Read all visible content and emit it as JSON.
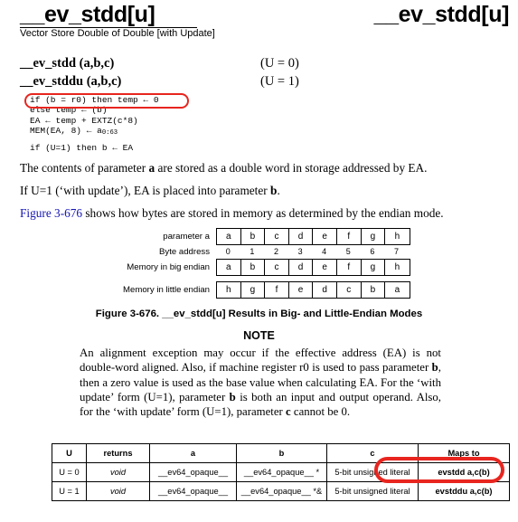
{
  "header": {
    "title_left": "__ev_stdd[u]",
    "title_right": "__ev_stdd[u]",
    "subtitle": "Vector Store Double of Double [with Update]"
  },
  "signatures": [
    {
      "name": "__ev_stdd (a,b,c)",
      "condition": "(U = 0)"
    },
    {
      "name": "__ev_stddu (a,b,c)",
      "condition": "(U = 1)"
    }
  ],
  "pseudocode": {
    "line1": "if (b = r0) then temp ← 0",
    "line2": "else temp ← (b)",
    "line3": "EA ← temp + EXTZ(c*8)",
    "line4_prefix": "MEM(EA, 8) ← a",
    "line4_sub": "0:63",
    "line5": "if (U=1) then b ← EA"
  },
  "paragraphs": {
    "p1_a": "The contents of parameter ",
    "p1_b": "a",
    "p1_c": " are stored as a double word in storage addressed by EA.",
    "p2_a": "If U=1 (‘with update’), EA is placed into parameter ",
    "p2_b": "b",
    "p2_c": ".",
    "p3_link": "Figure 3-676",
    "p3_rest": " shows how bytes are stored in memory as determined by the endian mode."
  },
  "byte_figure": {
    "rows": [
      {
        "label": "parameter a",
        "boxed": true,
        "cells": [
          "a",
          "b",
          "c",
          "d",
          "e",
          "f",
          "g",
          "h"
        ]
      },
      {
        "label": "Byte address",
        "boxed": false,
        "cells": [
          "0",
          "1",
          "2",
          "3",
          "4",
          "5",
          "6",
          "7"
        ]
      },
      {
        "label": "Memory in big endian",
        "boxed": true,
        "cells": [
          "a",
          "b",
          "c",
          "d",
          "e",
          "f",
          "g",
          "h"
        ]
      },
      {
        "label": "Memory in little endian",
        "boxed": true,
        "cells": [
          "h",
          "g",
          "f",
          "e",
          "d",
          "c",
          "b",
          "a"
        ]
      }
    ],
    "caption": "Figure 3-676.  __ev_stdd[u] Results in Big- and Little-Endian Modes"
  },
  "note": {
    "title": "NOTE",
    "body_1": "An alignment exception may occur if the effective address (EA) is not double-word aligned. Also, if machine register r0 is used to pass parameter ",
    "body_b1": "b",
    "body_2": ", then a zero value is used as the base value when calculating EA. For the ‘with update’ form (U=1), parameter ",
    "body_b2": "b",
    "body_3": " is both an input and output operand. Also, for the ‘with update’ form (U=1), parameter ",
    "body_b3": "c",
    "body_4": " cannot be 0."
  },
  "mapping_table": {
    "headers": [
      "U",
      "returns",
      "a",
      "b",
      "c",
      "Maps to"
    ],
    "rows": [
      {
        "u": "U = 0",
        "returns": "void",
        "a": "__ev64_opaque__",
        "b": "__ev64_opaque__ *",
        "c": "5-bit unsigned literal",
        "maps_to": "evstdd a,c(b)"
      },
      {
        "u": "U = 1",
        "returns": "void",
        "a": "__ev64_opaque__",
        "b": "__ev64_opaque__ *&",
        "c": "5-bit unsigned literal",
        "maps_to": "evstddu a,c(b)"
      }
    ]
  },
  "annotations": {
    "highlight_color": "#e8251f",
    "link_color": "#1414b4"
  }
}
